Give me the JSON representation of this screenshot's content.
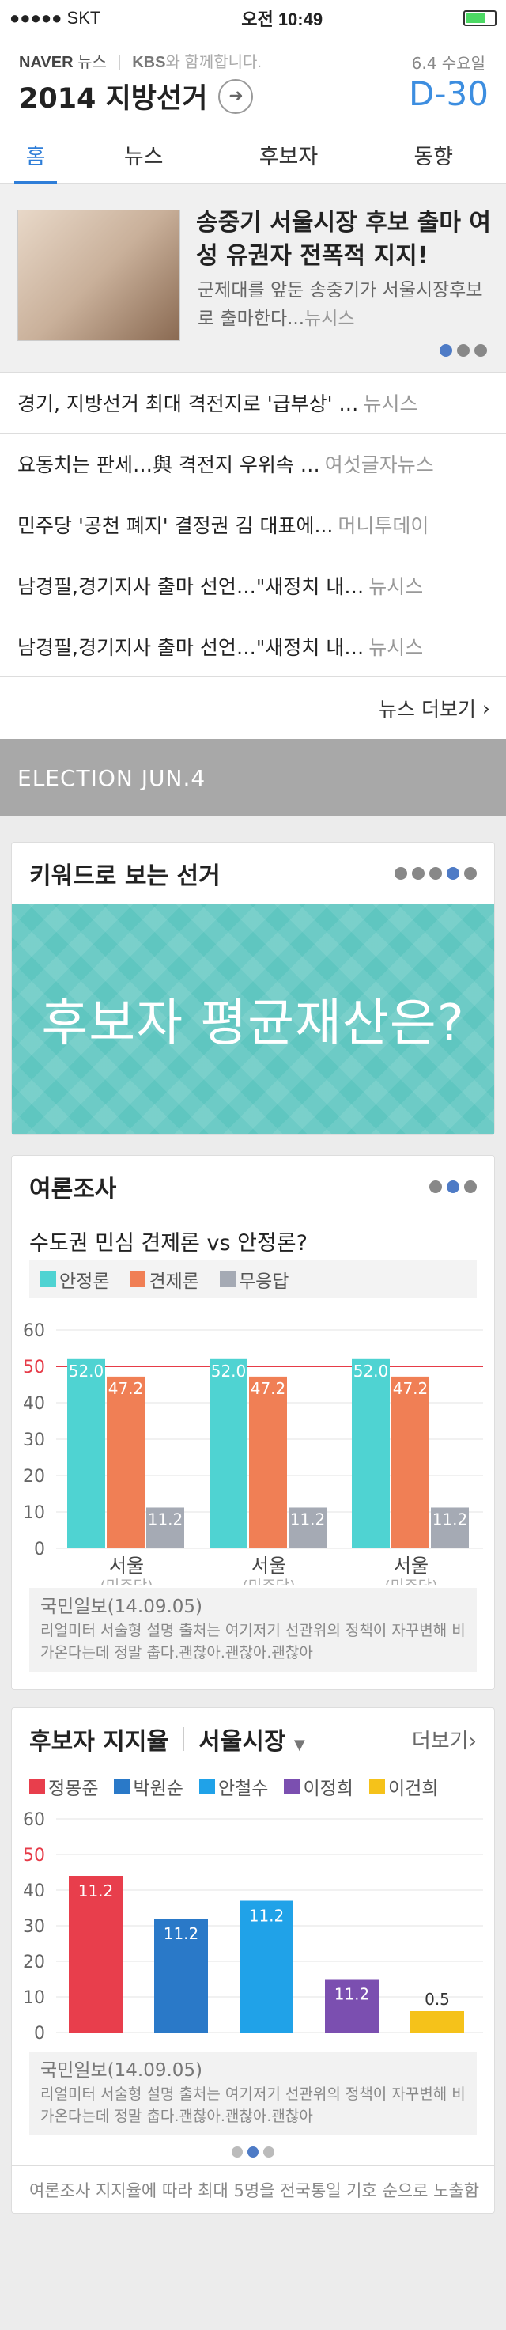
{
  "status": {
    "carrier": "●●●●● SKT",
    "time": "오전 10:49"
  },
  "header": {
    "naver": "NAVER",
    "news": "뉴스",
    "partner": "KBS",
    "partner_suffix": "와 함께합니다.",
    "title": "2014 지방선거",
    "date": "6.4 수요일",
    "dday": "D-30"
  },
  "tabs": [
    "홈",
    "뉴스",
    "후보자",
    "동향"
  ],
  "featured": {
    "title": "송중기 서울시장 후보 출마 여성 유권자 전폭적 지지!",
    "desc": "군제대를 앞둔 송중기가 서울시장후보로 출마한다...",
    "source": "뉴시스"
  },
  "news": [
    {
      "title": "경기, 지방선거 최대 격전지로 '급부상' …",
      "source": "뉴시스"
    },
    {
      "title": "요동치는 판세…與 격전지 우위속 …",
      "source": "여섯글자뉴스"
    },
    {
      "title": "민주당 '공천 폐지' 결정권 김 대표에...",
      "source": "머니투데이"
    },
    {
      "title": "남경필,경기지사 출마 선언…\"새정치 내…",
      "source": "뉴시스"
    },
    {
      "title": "남경필,경기지사 출마 선언…\"새정치 내…",
      "source": "뉴시스"
    }
  ],
  "news_more": "뉴스 더보기",
  "election_banner": "ELECTION JUN.4",
  "keyword": {
    "title": "키워드로 보는 선거",
    "banner": "후보자 평균재산은?"
  },
  "poll": {
    "title": "여론조사",
    "question": "수도권 민심 견제론 vs 안정론?",
    "source": "국민일보(14.09.05)",
    "desc": "리얼미터 서술형 설명 출처는 여기저기 선관위의 정책이 자꾸변해 비가온다는데 정말 춥다.괜찮아.괜찮아.괜찮아"
  },
  "support": {
    "title": "후보자 지지율",
    "region": "서울시장",
    "more": "더보기",
    "source": "국민일보(14.09.05)",
    "desc": "리얼미터 서술형 설명 출처는 여기저기 선관위의 정책이 자꾸변해 비가온다는데 정말 춥다.괜찮아.괜찮아.괜찮아"
  },
  "footnote": "여론조사 지지율에 따라 최대 5명을 전국통일 기호 순으로 노출함",
  "colors": {
    "accent": "#2f7ed8",
    "stable": "#4fd3d2",
    "check": "#f07f55",
    "none": "#a5aab4",
    "red_line": "#e63b48"
  },
  "chart_data": [
    {
      "type": "bar",
      "categories": [
        "서울",
        "서울",
        "서울"
      ],
      "sublabels": [
        "(민주당)",
        "(민주당)",
        "(민주당)"
      ],
      "series": [
        {
          "name": "안정론",
          "color": "#4fd3d2",
          "values": [
            52.0,
            52.0,
            52.0
          ]
        },
        {
          "name": "견제론",
          "color": "#f07f55",
          "values": [
            47.2,
            47.2,
            47.2
          ]
        },
        {
          "name": "무응답",
          "color": "#a5aab4",
          "values": [
            11.2,
            11.2,
            11.2
          ]
        }
      ],
      "yticks": [
        0,
        10,
        20,
        30,
        40,
        50,
        60
      ],
      "ylim": [
        0,
        60
      ],
      "reference_line": 50
    },
    {
      "type": "bar",
      "categories": [
        "정몽준",
        "박원순",
        "안철수",
        "이정희",
        "이건희"
      ],
      "colors": [
        "#e83e4c",
        "#2a79c8",
        "#20a2e8",
        "#7b4fb0",
        "#f5c21a"
      ],
      "values": [
        44,
        32,
        37,
        15,
        6
      ],
      "labels": [
        "11.2",
        "11.2",
        "11.2",
        "11.2",
        "0.5"
      ],
      "yticks": [
        0,
        10,
        20,
        30,
        40,
        50,
        60
      ],
      "ylim": [
        0,
        60
      ],
      "reference_line": 50
    }
  ]
}
